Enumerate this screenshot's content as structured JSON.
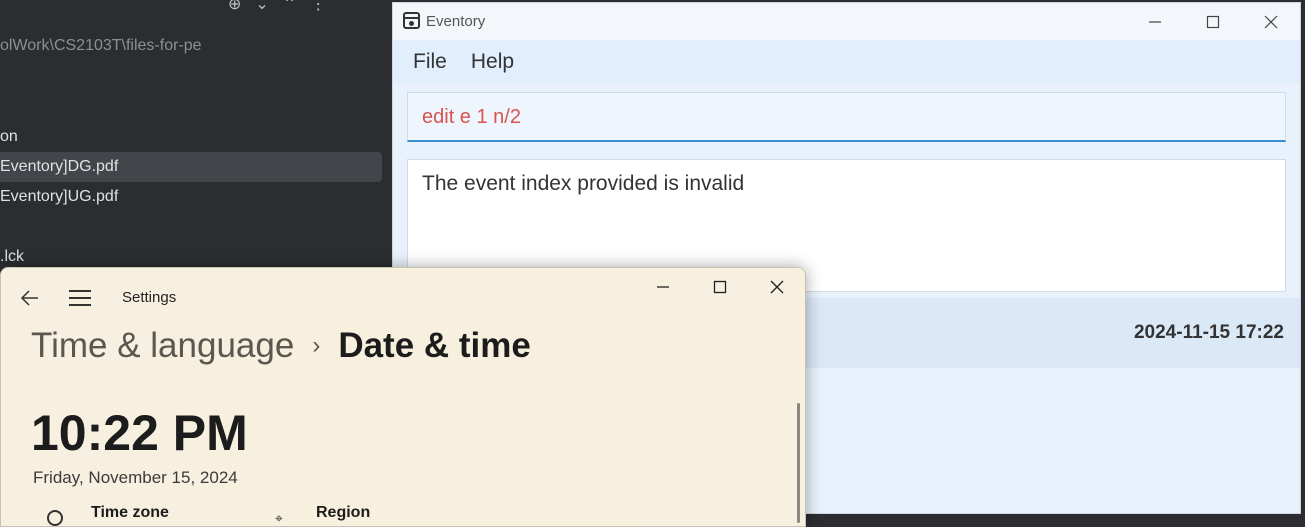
{
  "ide": {
    "path": "olWork\\CS2103T\\files-for-pe",
    "items": [
      "on",
      "Eventory]DG.pdf",
      "Eventory]UG.pdf",
      ".lck"
    ]
  },
  "eventory": {
    "title": "Eventory",
    "menu": {
      "file": "File",
      "help": "Help"
    },
    "command_value": "edit e 1 n/2",
    "result_text": "The event index provided is invalid",
    "event_datetime": "2024-11-15 17:22",
    "colors": {
      "command_text": "#d9534f",
      "input_focus": "#3b8fd1",
      "background": "#e9f2fc"
    }
  },
  "settings": {
    "app_title": "Settings",
    "breadcrumb_parent": "Time & language",
    "breadcrumb_current": "Date & time",
    "time": "10:22 PM",
    "date": "Friday, November 15, 2024",
    "time_zone_label": "Time zone",
    "region_label": "Region"
  }
}
